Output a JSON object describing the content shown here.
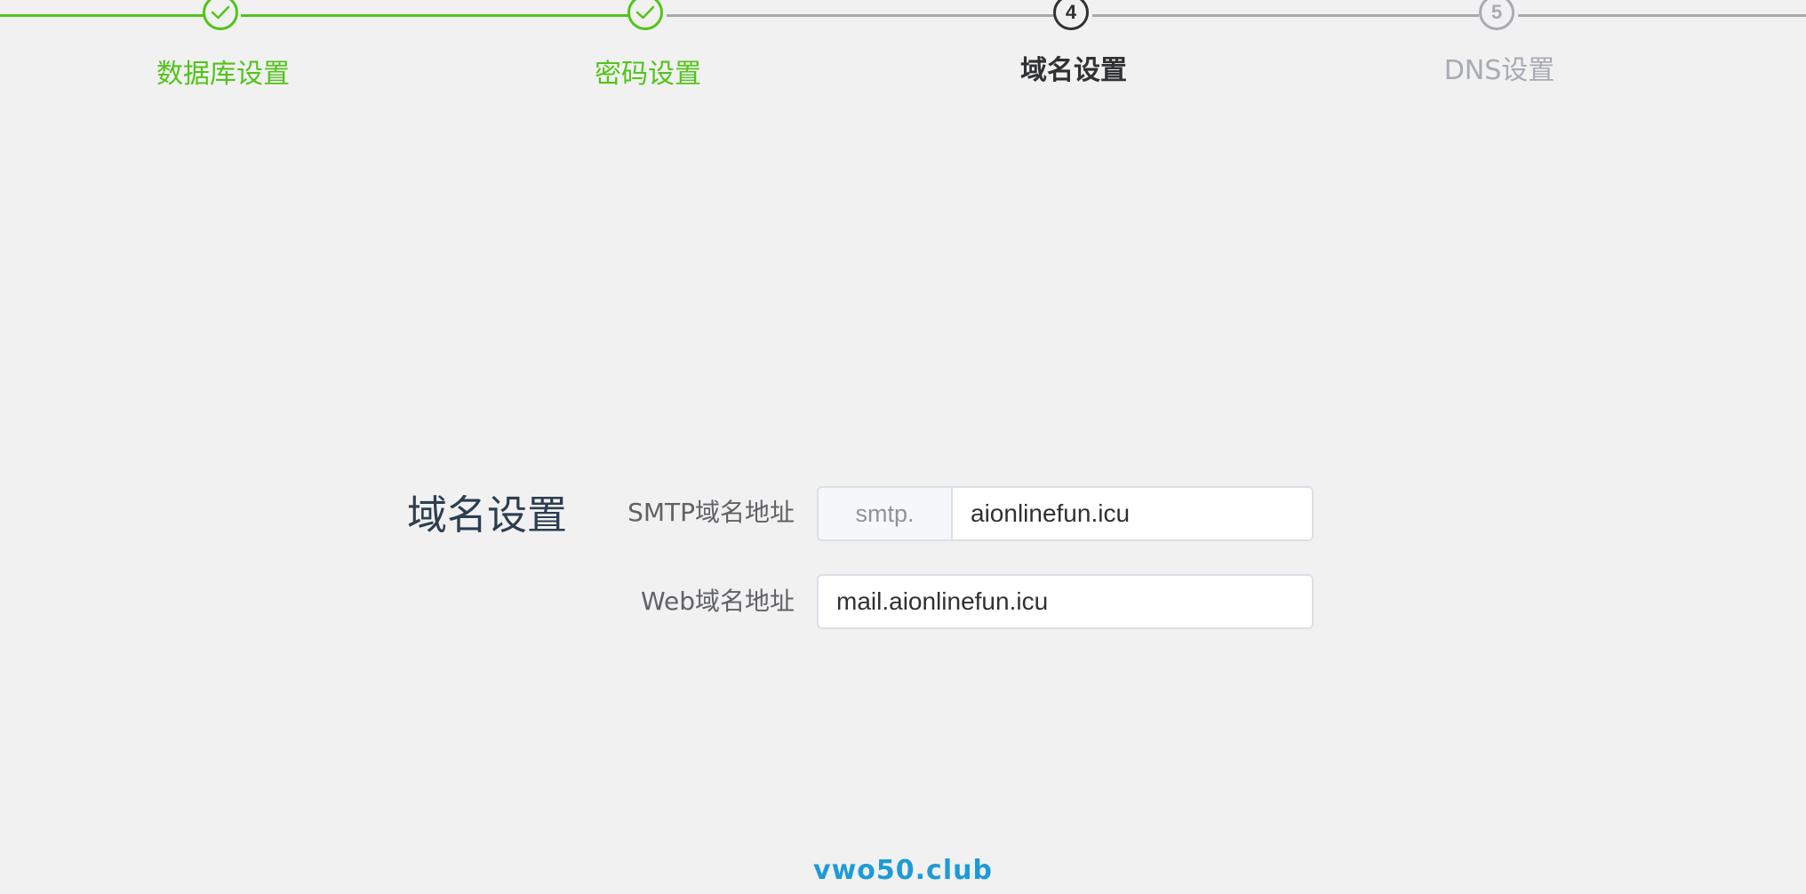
{
  "steps": [
    {
      "label": "数据库设置",
      "status": "done",
      "icon": "check-icon"
    },
    {
      "label": "密码设置",
      "status": "done",
      "icon": "check-icon"
    },
    {
      "label": "域名设置",
      "status": "active",
      "number": "4"
    },
    {
      "label": "DNS设置",
      "status": "todo",
      "number": "5"
    }
  ],
  "section": {
    "title": "域名设置"
  },
  "form": {
    "smtp_label": "SMTP域名地址",
    "smtp_prefix": "smtp.",
    "smtp_value": "aionlinefun.icu",
    "web_label": "Web域名地址",
    "web_value": "mail.aionlinefun.icu"
  },
  "footer": {
    "brand": "vwo50.club"
  },
  "colors": {
    "done": "#52c41a",
    "active": "#303133",
    "todo": "#a8abb2",
    "brand": "#1e9bd7"
  }
}
